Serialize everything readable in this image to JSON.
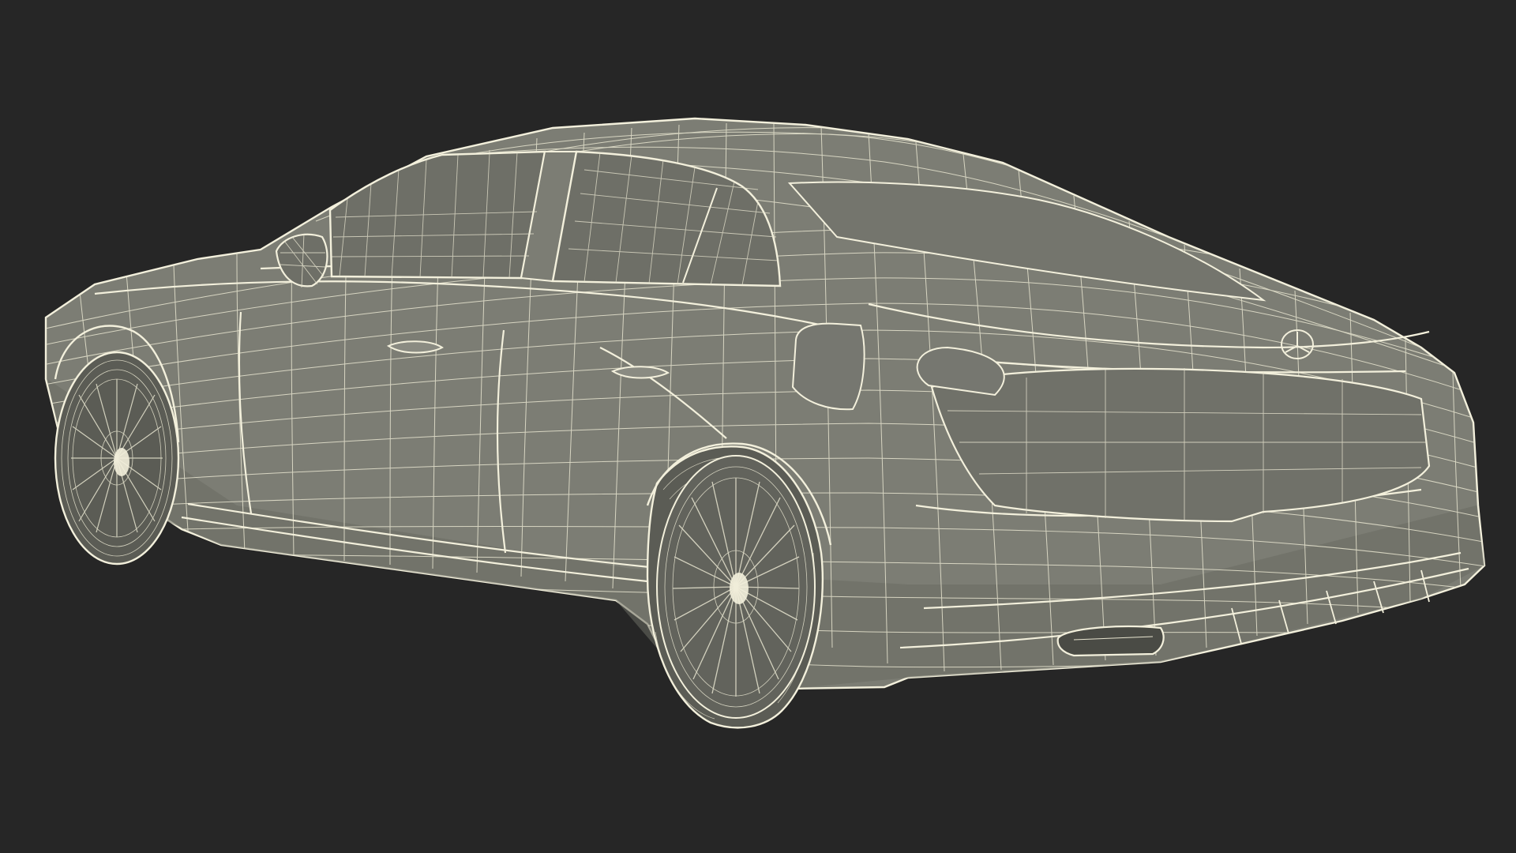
{
  "scene": {
    "subject": "wireframe-sedan-rear-three-quarter",
    "background_color": "#262626",
    "body_fill": "#7c7d74",
    "body_shadow": "#5f6058",
    "glass_fill": "#6e6f67",
    "tire_fill": "#5b5c55",
    "wire_color": "#f3f0dc",
    "wire_color_dim": "#d9d6c2",
    "icons": [
      "car-wireframe-icon",
      "brand-emblem-icon",
      "wheel-icon"
    ]
  }
}
